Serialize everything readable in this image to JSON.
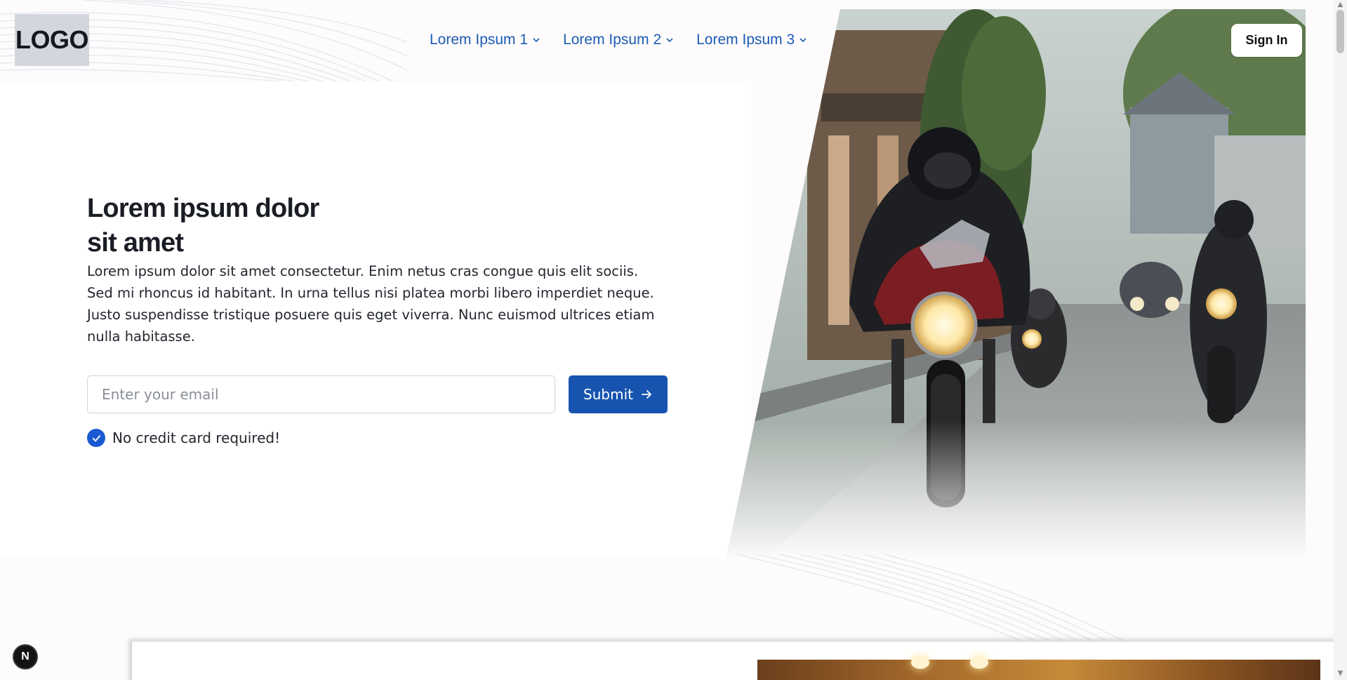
{
  "header": {
    "logo_text": "LOGO",
    "nav": [
      {
        "label": "Lorem Ipsum 1",
        "icon": "chevron-down-icon"
      },
      {
        "label": "Lorem Ipsum 2",
        "icon": "chevron-down-icon"
      },
      {
        "label": "Lorem Ipsum 3",
        "icon": "chevron-down-icon"
      }
    ],
    "signin_label": "Sign In"
  },
  "hero": {
    "title_line1": "Lorem ipsum dolor",
    "title_line2": "sit amet",
    "description": "Lorem ipsum dolor sit amet consectetur. Enim netus cras congue quis elit sociis. Sed mi rhoncus id habitant. In urna tellus nisi platea morbi libero imperdiet neque. Justo suspendisse tristique posuere quis eget viverra. Nunc euismod ultrices etiam nulla habitasse.",
    "email_placeholder": "Enter your email",
    "submit_label": "Submit",
    "submit_icon": "arrow-right-icon",
    "note": "No credit card required!",
    "note_icon": "check-circle-icon",
    "image": "motorcycle-riders-photo"
  },
  "floating": {
    "label": "N"
  },
  "colors": {
    "accent": "#1754b0",
    "nav_link": "#1d5bb4",
    "check": "#1c5ad4"
  }
}
